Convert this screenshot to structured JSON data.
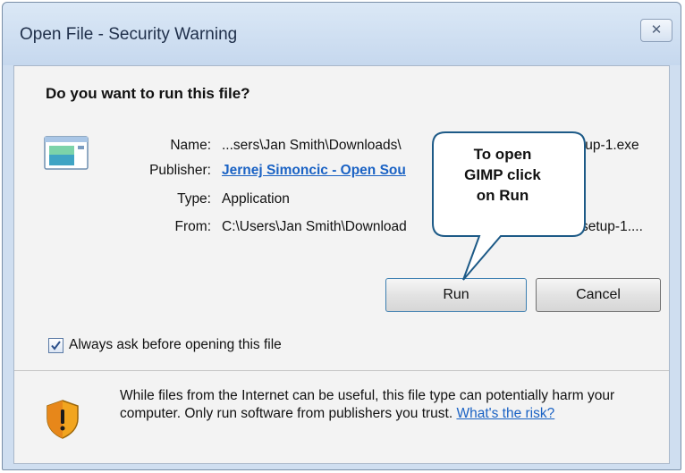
{
  "window": {
    "title": "Open File - Security Warning",
    "close_glyph": "✕"
  },
  "question": "Do you want to run this file?",
  "file_info": {
    "name_label": "Name:",
    "name_value": "...sers\\Jan Smith\\Downloads\\",
    "name_value_tail": "tup-1.exe",
    "publisher_label": "Publisher:",
    "publisher_value": "Jernej Simoncic - Open Sou",
    "type_label": "Type:",
    "type_value": "Application",
    "from_label": "From:",
    "from_value": "C:\\Users\\Jan Smith\\Download",
    "from_value_tail": "setup-1...."
  },
  "buttons": {
    "run_label": "Run",
    "cancel_label": "Cancel"
  },
  "checkbox": {
    "label": "Always ask before opening this file",
    "checked": true
  },
  "warning": {
    "text": "While files from the Internet can be useful, this file type can potentially harm your computer. Only run software from publishers you trust.",
    "link": "What's the risk?"
  },
  "callout": {
    "lines": [
      "To open",
      "GIMP click",
      "on Run"
    ]
  },
  "colors": {
    "link": "#1a62c4",
    "titlebar": "#c6d8ee",
    "callout_border": "#1d5a87"
  },
  "icons": [
    "file-icon",
    "shield-warning-icon",
    "close-icon",
    "checkmark-icon"
  ]
}
